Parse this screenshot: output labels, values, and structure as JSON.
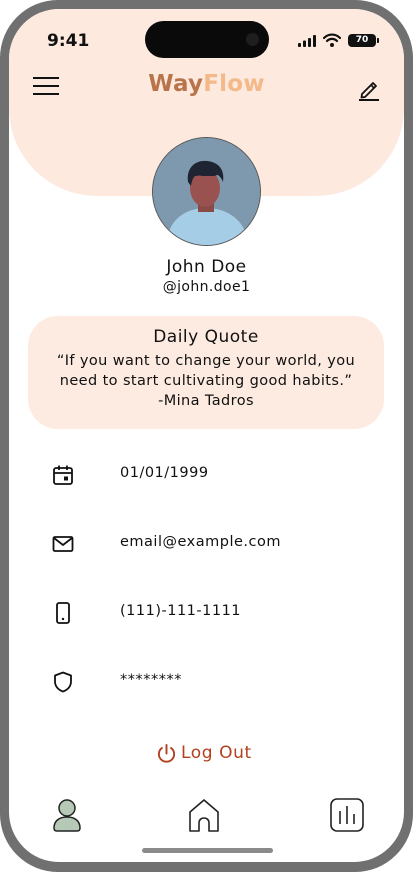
{
  "status_bar": {
    "time": "9:41",
    "battery": "70"
  },
  "header": {
    "logo_part1": "Way",
    "logo_part2": "Flow",
    "menu_icon": "hamburger-menu-icon",
    "edit_icon": "pencil-edit-icon"
  },
  "profile": {
    "name": "John Doe",
    "handle": "@john.doe1",
    "avatar_icon": "user-avatar"
  },
  "quote": {
    "title": "Daily Quote",
    "text": "“If you want to change your world, you need to start cultivating good habits.” -Mina Tadros"
  },
  "details": [
    {
      "icon": "calendar-icon",
      "value": "01/01/1999"
    },
    {
      "icon": "mail-icon",
      "value": "email@example.com"
    },
    {
      "icon": "phone-icon",
      "value": "(111)-111-1111"
    },
    {
      "icon": "shield-icon",
      "value": "********"
    }
  ],
  "logout": {
    "label": "Log Out",
    "icon": "power-icon",
    "color": "#b3401e"
  },
  "tab_bar": [
    {
      "icon": "profile-icon",
      "active": true
    },
    {
      "icon": "home-icon",
      "active": false
    },
    {
      "icon": "stats-icon",
      "active": false
    }
  ],
  "colors": {
    "header_bg": "#fde9de",
    "quote_bg": "#fdebe1",
    "logo_dark": "#b8744a",
    "logo_light": "#f3b98a",
    "accent_green": "#b5c9b6"
  }
}
